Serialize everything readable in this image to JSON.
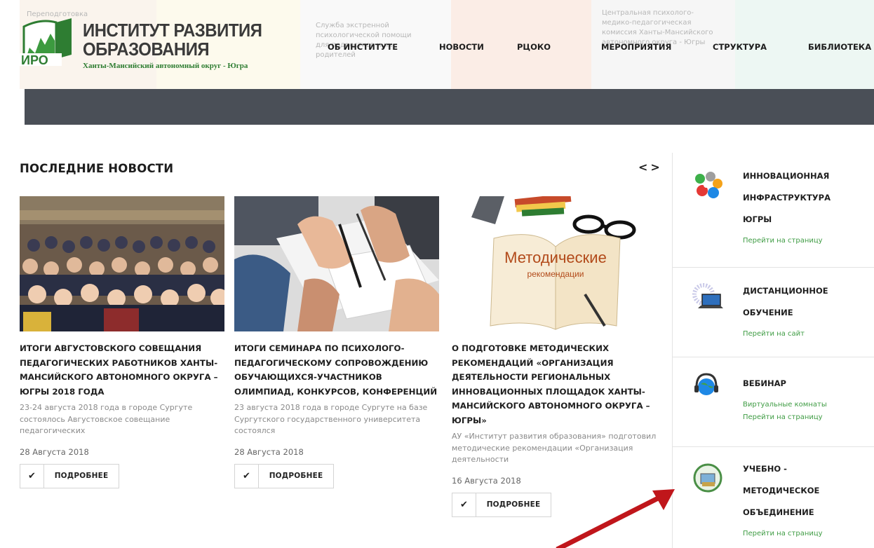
{
  "header": {
    "logo": {
      "line1": "ИНСТИТУТ РАЗВИТИЯ",
      "line2": "ОБРАЗОВАНИЯ",
      "abbr": "ИРО",
      "subtitle": "Ханты-Мансийский автономный округ - Югра"
    },
    "background_faint_texts": [
      "Переподготовка",
      "Служба экстренной психологической помощи для подростков и их родителей",
      "Центральная психолого-медико-педагогическая комиссия Ханты-Мансийского автономного округа - Югры"
    ],
    "nav": [
      "ОБ ИНСТИТУТЕ",
      "НОВОСТИ",
      "РЦОКО",
      "МЕРОПРИЯТИЯ",
      "СТРУКТУРА",
      "БИБЛИОТЕКА"
    ]
  },
  "news": {
    "title": "ПОСЛЕДНИЕ НОВОСТИ",
    "prev_symbol": "<",
    "next_symbol": ">",
    "more_label": "ПОДРОБНЕЕ",
    "items": [
      {
        "headline": "ИТОГИ АВГУСТОВСКОГО СОВЕЩАНИЯ ПЕДАГОГИЧЕСКИХ РАБОТНИКОВ ХАНТЫ-МАНСИЙСКОГО АВТОНОМНОГО ОКРУГА – ЮГРЫ 2018 ГОДА",
        "desc": "23-24 августа 2018 года в городе Сургуте состоялось Августовское совещание педагогических",
        "date": "28 Августа 2018"
      },
      {
        "headline": "ИТОГИ СЕМИНАРА ПО ПСИХОЛОГО-ПЕДАГОГИЧЕСКОМУ СОПРОВОЖДЕНИЮ ОБУЧАЮЩИХСЯ-УЧАСТНИКОВ ОЛИМПИАД, КОНКУРСОВ, КОНФЕРЕНЦИЙ",
        "desc": "23 августа 2018 года в городе Сургуте на базе Сургутского государственного университета состоялся",
        "date": "28 Августа 2018"
      },
      {
        "headline": "О ПОДГОТОВКЕ МЕТОДИЧЕСКИХ РЕКОМЕНДАЦИЙ «ОРГАНИЗАЦИЯ ДЕЯТЕЛЬНОСТИ РЕГИОНАЛЬНЫХ ИННОВАЦИОННЫХ ПЛОЩАДОК ХАНТЫ-МАНСИЙСКОГО АВТОНОМНОГО ОКРУГА – ЮГРЫ»",
        "desc": "АУ «Институт развития образования» подготовил методические рекомендации «Организация деятельности",
        "date": "16 Августа 2018",
        "image_caption": "Методические",
        "image_caption2": "рекомендации"
      }
    ]
  },
  "sidebar": {
    "items": [
      {
        "title1": "ИННОВАЦИОННАЯ",
        "title2": "ИНФРАСТРУКТУРА",
        "title3": "ЮГРЫ",
        "sub": "",
        "link": "Перейти на страницу"
      },
      {
        "title1": "ДИСТАНЦИОННОЕ",
        "title2": "ОБУЧЕНИЕ",
        "title3": "",
        "sub": "",
        "link": "Перейти на сайт"
      },
      {
        "title1": "ВЕБИНАР",
        "title2": "",
        "title3": "",
        "sub": "Виртуальные комнаты",
        "link": "Перейти на страницу"
      },
      {
        "title1": "УЧЕБНО -",
        "title2": "МЕТОДИЧЕСКОЕ",
        "title3": "ОБЪЕДИНЕНИЕ",
        "sub": "",
        "link": "Перейти на страницу"
      }
    ]
  },
  "colors": {
    "accent_green": "#3f9c44",
    "dark_band": "#4a4f57",
    "annotation_arrow": "#c0161b"
  }
}
